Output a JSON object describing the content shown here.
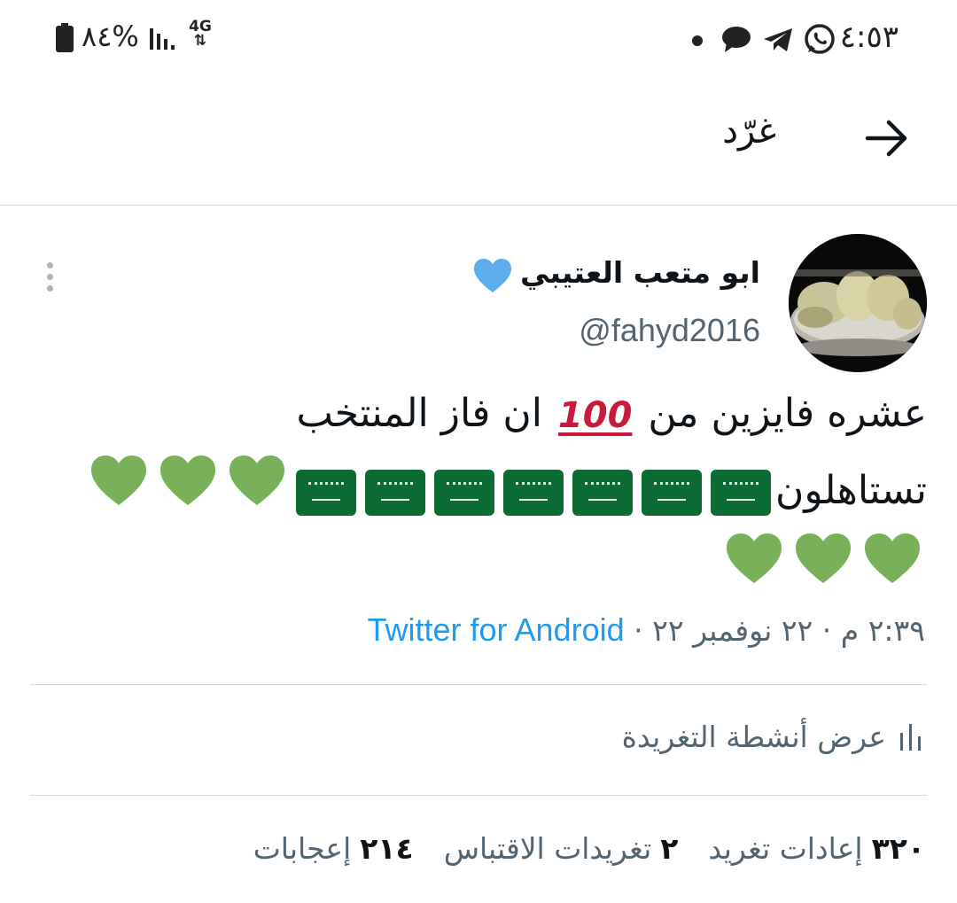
{
  "status_bar": {
    "time": "٤:٥٣",
    "battery_percent": "%٨٤",
    "network": "4G",
    "icons": [
      "whatsapp-icon",
      "telegram-icon",
      "message-icon",
      "notification-dot-icon",
      "signal-icon",
      "battery-icon"
    ]
  },
  "header": {
    "title": "غرّد",
    "back_icon": "arrow-right-icon"
  },
  "tweet": {
    "display_name": "ابو متعب العتيبي",
    "handle": "@fahyd2016",
    "text_line1_a": "عشره فايزين من",
    "hundred_emoji": "💯",
    "text_line1_b": "ان فاز المنتخب",
    "text_line2": "تستاهلون",
    "flag_count": 7,
    "heart_count": 6,
    "time": "٢:٣٩ م",
    "date": "٢٢ نوفمبر ٢٢",
    "separator": "·",
    "source": "Twitter for Android"
  },
  "activity": {
    "label": "عرض أنشطة التغريدة",
    "icon": "bar-chart-icon"
  },
  "stats": {
    "retweets_count": "٣٢٠",
    "retweets_label": "إعادات تغريد",
    "quotes_count": "٢",
    "quotes_label": "تغريدات الاقتباس",
    "likes_count": "٢١٤",
    "likes_label": "إعجابات"
  },
  "colors": {
    "accent": "#1d9bf0",
    "secondary_text": "#536471",
    "green_heart": "#78b159",
    "blue_heart": "#5dadec",
    "flag_green": "#0b6b33"
  }
}
